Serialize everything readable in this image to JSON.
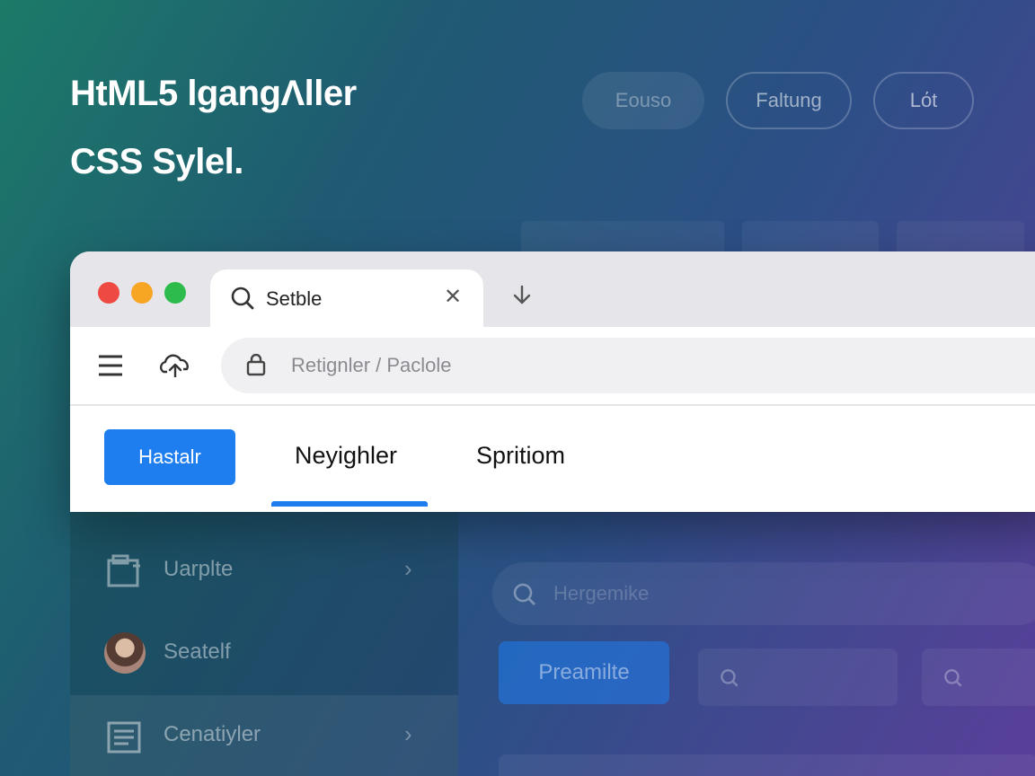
{
  "hero": {
    "line1": "HtML5 lgangΛller",
    "line2": "CSS Sylel."
  },
  "header_pills": [
    "Eouso",
    "Faltung",
    "Lόt"
  ],
  "browser": {
    "traffic_lights": [
      "close",
      "minimize",
      "maximize"
    ],
    "tab": {
      "icon": "search-icon",
      "label": "Setble",
      "close_icon": "close-icon"
    },
    "download_icon": "arrow-down-icon",
    "toolbar": {
      "menu_icon": "hamburger-icon",
      "cloud_icon": "cloud-upload-icon",
      "address_icon": "lock-icon",
      "address_text": "Retignler / Paclole"
    },
    "nav": {
      "primary_button": "Hastalr",
      "tabs": [
        "Neyighler",
        "Spritiom"
      ],
      "active_tab_index": 0
    }
  },
  "sidebar": {
    "items": [
      {
        "icon": "folder-icon",
        "label": "Uarplte",
        "has_chevron": true
      },
      {
        "icon": "avatar",
        "label": "Seatelf",
        "has_chevron": false
      },
      {
        "icon": "document-icon",
        "label": "Cenatiyler",
        "has_chevron": true
      }
    ]
  },
  "content": {
    "search_placeholder": "Hergemike",
    "action_button": "Preamilte"
  },
  "colors": {
    "accent": "#1e7ef0",
    "traffic_red": "#ee4a43",
    "traffic_yellow": "#f6a623",
    "traffic_green": "#2dbb4c"
  }
}
